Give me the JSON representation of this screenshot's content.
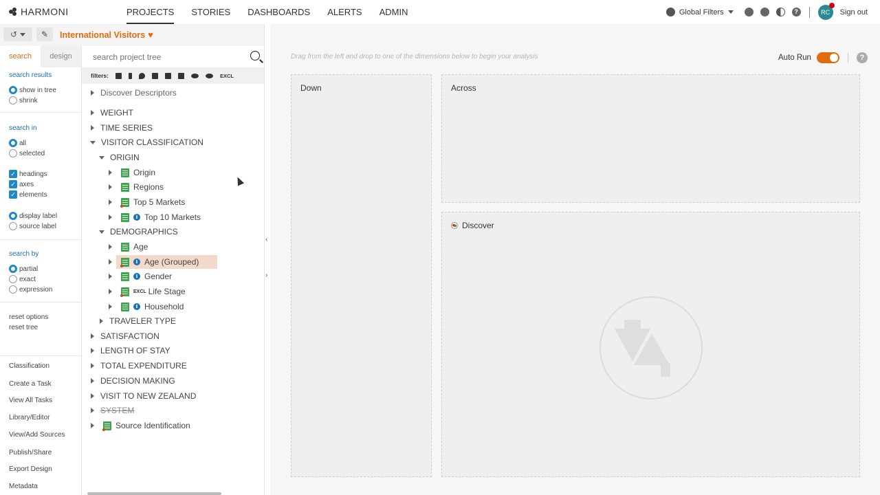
{
  "app": {
    "logo": "HARMONI",
    "nav": [
      "PROJECTS",
      "STORIES",
      "DASHBOARDS",
      "ALERTS",
      "ADMIN"
    ],
    "global_filters": "Global Filters",
    "avatar_initials": "RC",
    "sign_out": "Sign out"
  },
  "project": {
    "title": "International Visitors"
  },
  "left_tabs": {
    "search": "search",
    "design": "design"
  },
  "options": {
    "search_results_heading": "search results",
    "show_in_tree": "show in tree",
    "shrink": "shrink",
    "search_in_heading": "search in",
    "all": "all",
    "selected": "selected",
    "headings": "headings",
    "axes": "axes",
    "elements": "elements",
    "display_label": "display label",
    "source_label": "source label",
    "search_by_heading": "search by",
    "partial": "partial",
    "exact": "exact",
    "expression": "expression",
    "reset_options": "reset options",
    "reset_tree": "reset tree"
  },
  "actions": [
    "Classification",
    "Create a Task",
    "View All Tasks",
    "Library/Editor",
    "View/Add Sources",
    "Publish/Share",
    "Export Design",
    "Metadata"
  ],
  "tree_search": {
    "placeholder": "search project tree"
  },
  "filters_label": "filters:",
  "filter_excl_label": "EXCL",
  "tree": {
    "discover_descriptors": "Discover Descriptors",
    "weight": "WEIGHT",
    "time_series": "TIME SERIES",
    "visitor_classification": "VISITOR CLASSIFICATION",
    "origin": "ORIGIN",
    "origin_items": [
      "Origin",
      "Regions",
      "Top 5 Markets",
      "Top 10 Markets"
    ],
    "demographics": "DEMOGRAPHICS",
    "demo_items": [
      "Age",
      "Age (Grouped)",
      "Gender",
      "Life Stage",
      "Household"
    ],
    "traveler_type": "TRAVELER TYPE",
    "satisfaction": "SATISFACTION",
    "length_of_stay": "LENGTH OF STAY",
    "total_expenditure": "TOTAL EXPENDITURE",
    "decision_making": "DECISION MAKING",
    "visit_nz": "VISIT TO NEW ZEALAND",
    "system": "SYSTEM",
    "source_identification": "Source Identification"
  },
  "canvas": {
    "hint": "Drag from the left and drop to one of the dimensions below to begin your analysis",
    "auto_run": "Auto Run",
    "down": "Down",
    "across": "Across",
    "discover": "Discover"
  },
  "colors": {
    "accent": "#e06c10",
    "link": "#1c6fb0",
    "check": "#1c8ac7",
    "tree_icon": "#3aa84a"
  }
}
